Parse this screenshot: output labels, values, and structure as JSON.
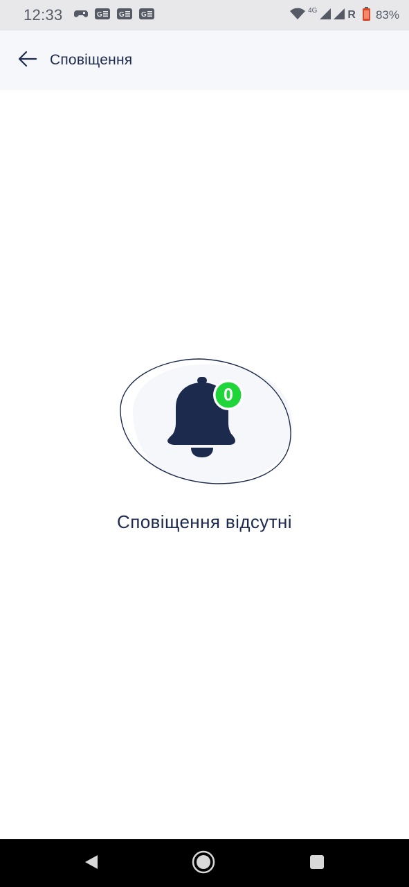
{
  "status_bar": {
    "time": "12:33",
    "network": "4G",
    "roaming": "R",
    "battery": "83%",
    "icons": [
      "game-controller-icon",
      "notification-g-icon",
      "notification-g-icon",
      "notification-g-icon",
      "wifi-icon",
      "signal-icon",
      "signal-icon",
      "battery-icon"
    ]
  },
  "app_bar": {
    "back_icon": "arrow-left-icon",
    "title": "Сповіщення"
  },
  "empty_state": {
    "icon": "bell-icon",
    "badge_count": "0",
    "message": "Сповіщення відсутні"
  },
  "nav_bar": {
    "icons": [
      "back-triangle-icon",
      "home-circle-icon",
      "recents-square-icon"
    ]
  },
  "colors": {
    "primary_dark": "#1c2a4d",
    "badge_green": "#1fd53a",
    "app_bar_bg": "#f5f7fb",
    "status_bar_bg": "#e8e8eb",
    "nav_bar_bg": "#000000"
  }
}
